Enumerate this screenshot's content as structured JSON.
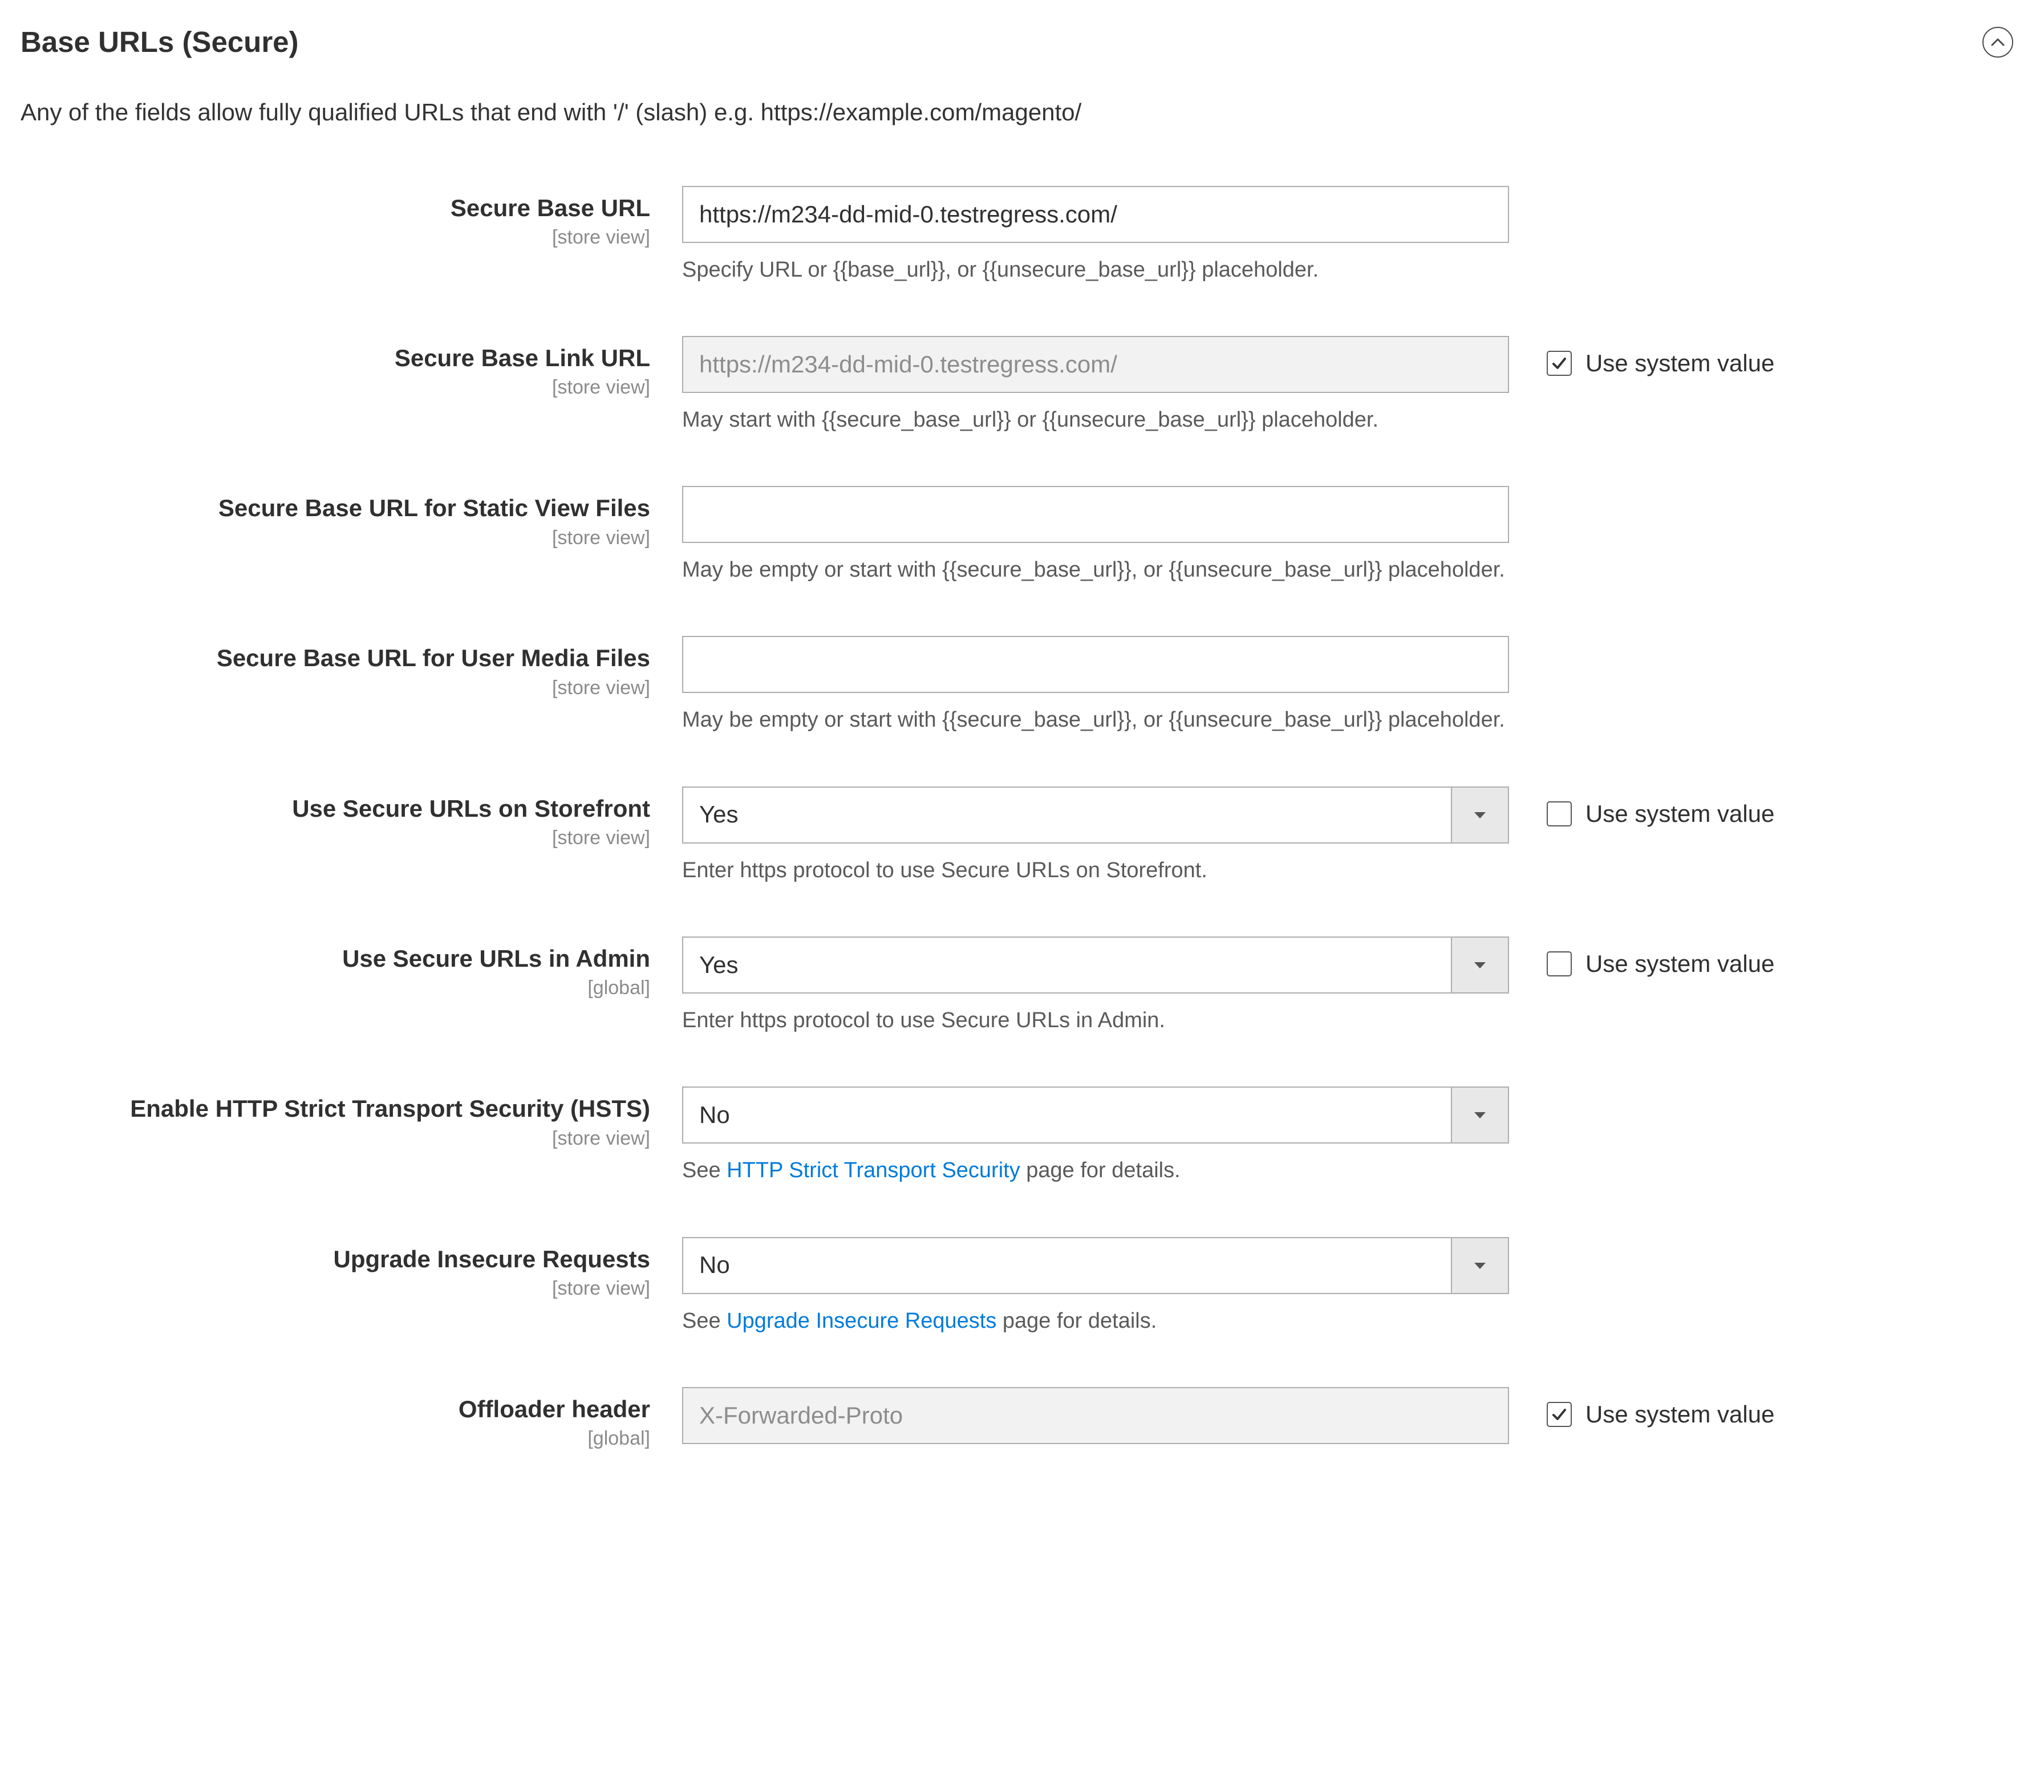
{
  "section": {
    "title": "Base URLs (Secure)",
    "hint": "Any of the fields allow fully qualified URLs that end with '/' (slash) e.g. https://example.com/magento/"
  },
  "scope": {
    "store_view": "[store view]",
    "global": "[global]"
  },
  "use_system_value_label": "Use system value",
  "fields": {
    "secure_base_url": {
      "label": "Secure Base URL",
      "value": "https://m234-dd-mid-0.testregress.com/",
      "help": "Specify URL or {{base_url}}, or {{unsecure_base_url}} placeholder."
    },
    "secure_base_link_url": {
      "label": "Secure Base Link URL",
      "value": "https://m234-dd-mid-0.testregress.com/",
      "help": "May start with {{secure_base_url}} or {{unsecure_base_url}} placeholder.",
      "use_system": true
    },
    "secure_base_static": {
      "label": "Secure Base URL for Static View Files",
      "value": "",
      "help": "May be empty or start with {{secure_base_url}}, or {{unsecure_base_url}} placeholder."
    },
    "secure_base_media": {
      "label": "Secure Base URL for User Media Files",
      "value": "",
      "help": "May be empty or start with {{secure_base_url}}, or {{unsecure_base_url}} placeholder."
    },
    "use_secure_storefront": {
      "label": "Use Secure URLs on Storefront",
      "value": "Yes",
      "help": "Enter https protocol to use Secure URLs on Storefront.",
      "use_system": false
    },
    "use_secure_admin": {
      "label": "Use Secure URLs in Admin",
      "value": "Yes",
      "help": "Enter https protocol to use Secure URLs in Admin.",
      "use_system": false
    },
    "hsts": {
      "label": "Enable HTTP Strict Transport Security (HSTS)",
      "value": "No",
      "help_before": "See ",
      "help_link": "HTTP Strict Transport Security",
      "help_after": " page for details."
    },
    "upgrade_insecure": {
      "label": "Upgrade Insecure Requests",
      "value": "No",
      "help_before": "See ",
      "help_link": "Upgrade Insecure Requests",
      "help_after": " page for details."
    },
    "offloader": {
      "label": "Offloader header",
      "value": "X-Forwarded-Proto",
      "use_system": true
    }
  }
}
